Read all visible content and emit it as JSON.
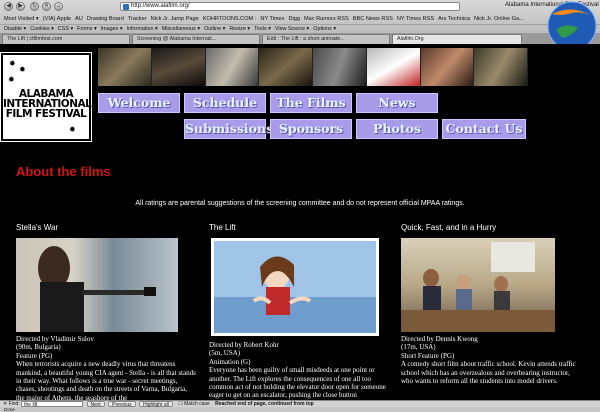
{
  "browser": {
    "url": "http://www.alafilm.org/",
    "window_title": "Alabama International Film Festival",
    "bookmarks": [
      "Most Visited ▾",
      "(VIA) Apple",
      "AU",
      "Drawing Board",
      "Tracker",
      "Nick Jr. Jamp Page",
      "KOHRTOONS.COM :",
      "NY Times",
      "Digg",
      "Mac Rumors RSS",
      "BBC News RSS",
      "NY Times RSS",
      "Ars Technica",
      "Nick Jr. Online Ga..."
    ],
    "devtools": [
      "Disable ▾",
      "Cookies ▾",
      "CSS ▾",
      "Forms ▾",
      "Images ▾",
      "Information ▾",
      "Miscellaneous ▾",
      "Outline ▾",
      "Resize ▾",
      "Tools ▾",
      "View Source ▾",
      "Options ▾"
    ],
    "tabs": [
      {
        "label": "The Lift | ctfilmfest.com"
      },
      {
        "label": "Screening @ Alabama Internati..."
      },
      {
        "label": "Edit : The Lift : a short animate..."
      },
      {
        "label": "Alafilm.Org"
      }
    ],
    "find_label": "Find:",
    "find_value": "the lift",
    "find_next": "Next",
    "find_previous": "Previous",
    "find_highlight": "Highlight all",
    "find_match_case": "Match case",
    "find_message": "Reached end of page, continued from top",
    "status": "Done"
  },
  "site": {
    "logo_text_lines": [
      "ALABAMA",
      "INTERNATIONAL",
      "FILM FESTIVAL"
    ],
    "nav": [
      {
        "label": "Welcome"
      },
      {
        "label": "Schedule"
      },
      {
        "label": "The Films"
      },
      {
        "label": "News"
      },
      {
        "label": "Submissions"
      },
      {
        "label": "Sponsors"
      },
      {
        "label": "Photos"
      },
      {
        "label": "Contact Us"
      }
    ],
    "section_title": "About the films",
    "disclaimer": "All ratings are parental suggestions of the screening committee and do not represent official MPAA ratings."
  },
  "films": [
    {
      "title": "Stella's War",
      "meta": [
        "Directed by Vladimir Sulov",
        "(90m, Bulgaria)",
        "Feature (PG)"
      ],
      "description": "When terrorists acquire a new deadly virus that threatens mankind, a beautiful young CIA agent - Stella - is all that stands in their way. What follows is a true war - secret meetings, chases, shootings and death on the streets of Varna, Bulgaria, the major of Athens, the seashore of the"
    },
    {
      "title": "The Lift",
      "meta": [
        "Directed by Robert Kohr",
        "(5m, USA)",
        "Animation (G)"
      ],
      "description": "Everyone has been guilty of small misdeeds at one point or another. The Lift explores the consequences of one all too common act of not holding the elevator door open for someone eager to get on an escalator, pushing the close button"
    },
    {
      "title": "Quick, Fast, and in a Hurry",
      "meta": [
        "Directed by Dennis Kwong",
        "(17m, USA)",
        "Short Feature (PG)"
      ],
      "description": "A comedy short film about traffic school. Kevin attends traffic school which has an overzealous and overbearing instructor, who wants to reform all the students into model drivers."
    }
  ]
}
